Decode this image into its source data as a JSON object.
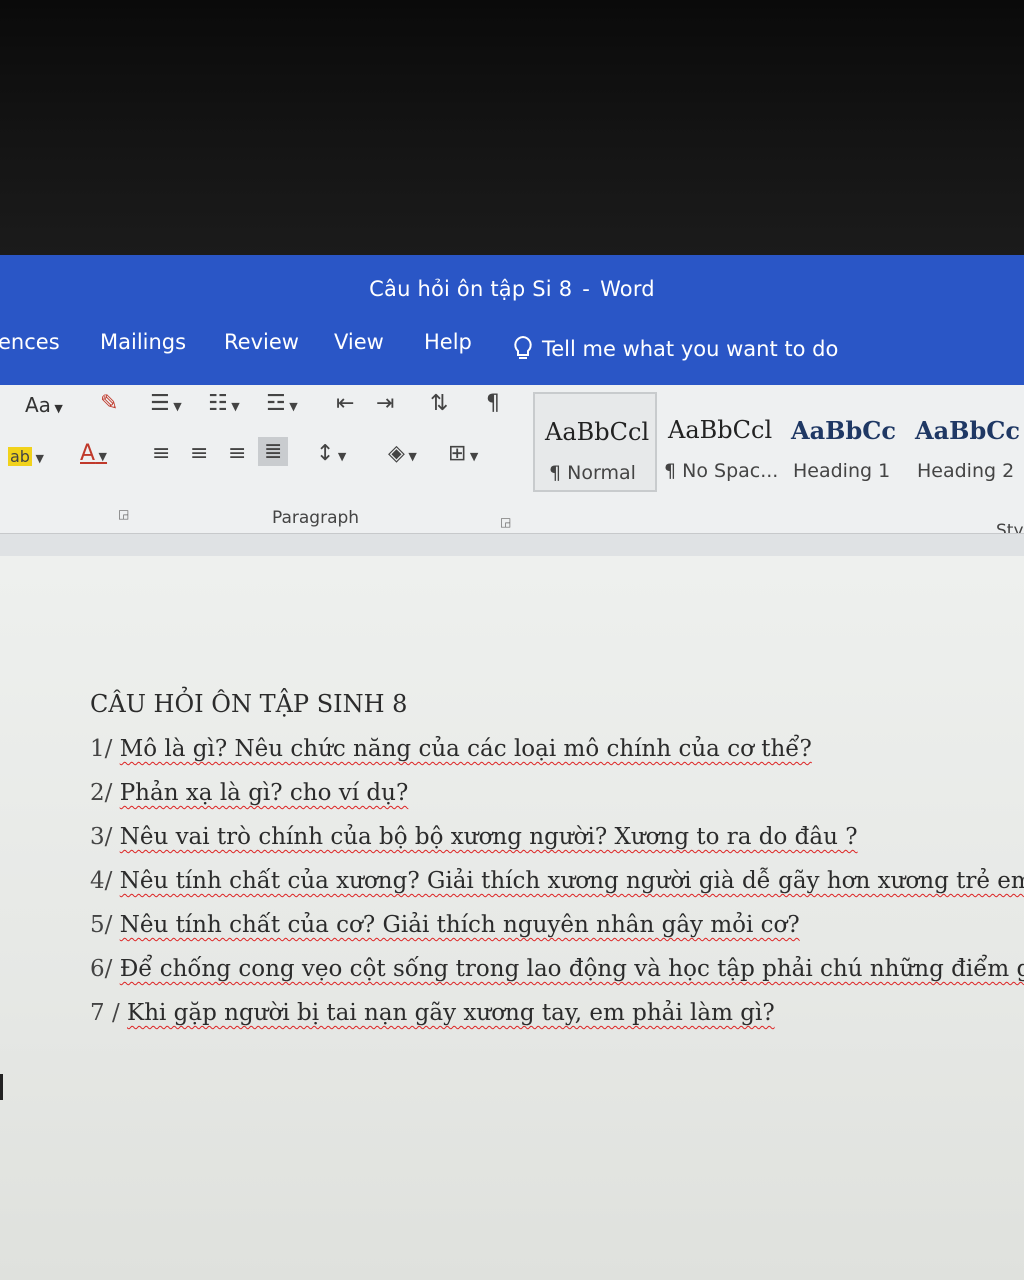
{
  "window": {
    "title_doc": "Câu hỏi ôn tập Si 8",
    "title_sep": "-",
    "title_app": "Word",
    "accent": "#2a56c6"
  },
  "menu": {
    "items": [
      "ences",
      "Mailings",
      "Review",
      "View",
      "Help"
    ],
    "tell_me": "Tell me what you want to do"
  },
  "ribbon": {
    "font_case_label": "Aa",
    "paragraph_group_label": "Paragraph",
    "styles_group_label": "Sty",
    "styles": [
      {
        "sample": "AaBbCcl",
        "name": "¶ Normal",
        "selected": true
      },
      {
        "sample": "AaBbCcl",
        "name": "¶ No Spac..."
      },
      {
        "sample": "AaBbCc",
        "name": "Heading 1"
      },
      {
        "sample": "AaBbCc",
        "name": "Heading 2"
      }
    ]
  },
  "document": {
    "title": "CÂU HỎI ÔN TẬP SINH 8",
    "questions": [
      {
        "num": "1/",
        "text": "Mô là gì? Nêu chức năng của các loại mô chính của cơ thể?"
      },
      {
        "num": "2/",
        "text": "Phản xạ là gì? cho ví dụ?"
      },
      {
        "num": "3/",
        "text": "Nêu vai trò chính của bộ bộ xương người? Xương to ra do đâu ?"
      },
      {
        "num": "4/",
        "text": "Nêu tính chất của xương? Giải thích xương người già dễ gãy hơn xương trẻ em?"
      },
      {
        "num": "5/",
        "text": "Nêu tính chất của cơ? Giải thích nguyên nhân gây mỏi cơ?"
      },
      {
        "num": "6/",
        "text": "Để chống cong vẹo cột sống trong lao động và học tập phải chú những điểm gì?"
      },
      {
        "num": "7 /",
        "text": "Khi gặp người bị tai nạn gãy xương tay, em phải làm gì?"
      }
    ]
  }
}
